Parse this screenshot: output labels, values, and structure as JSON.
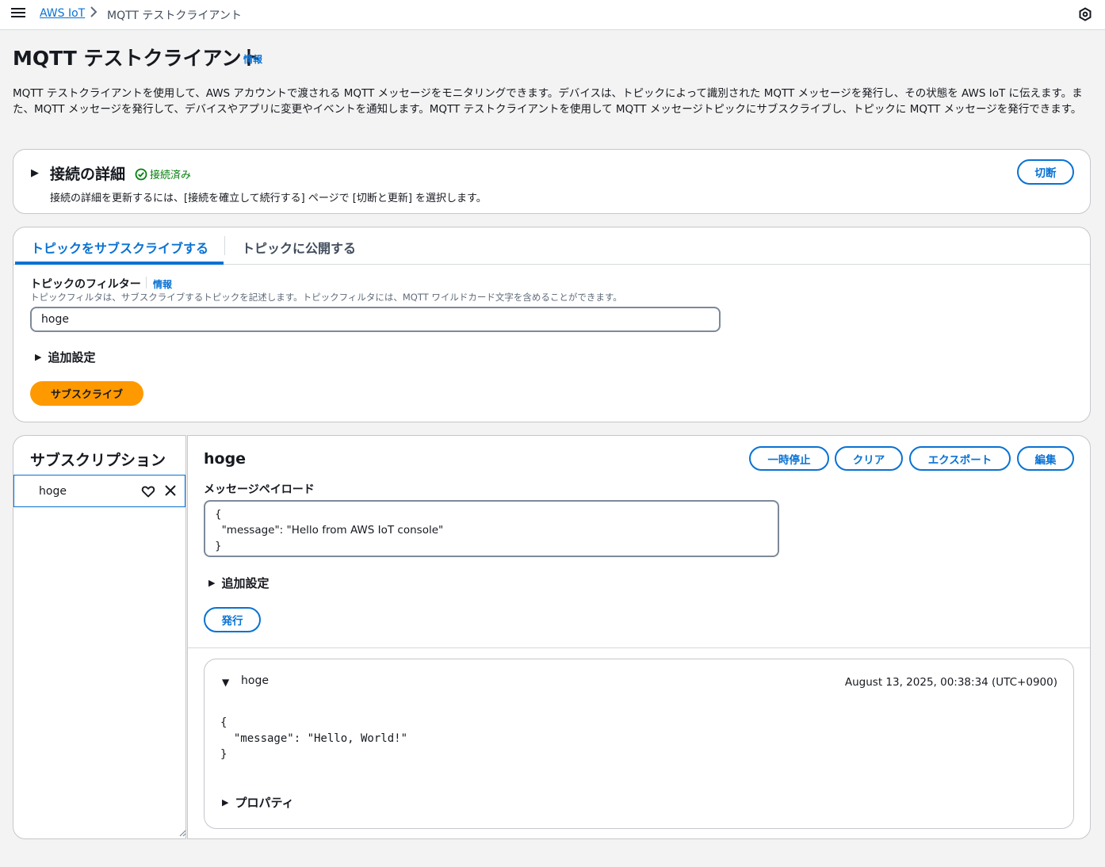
{
  "breadcrumb": {
    "root": "AWS IoT",
    "separator": "›",
    "current": "MQTT テストクライアント"
  },
  "page": {
    "title": "MQTT テストクライアント",
    "info": "情報",
    "description": "MQTT テストクライアントを使用して、AWS アカウントで渡される MQTT メッセージをモニタリングできます。デバイスは、トピックによって識別された MQTT メッセージを発行し、その状態を AWS IoT に伝えます。また、MQTT メッセージを発行して、デバイスやアプリに変更やイベントを通知します。MQTT テストクライアントを使用して MQTT メッセージトピックにサブスクライブし、トピックに MQTT メッセージを発行できます。"
  },
  "connection": {
    "title": "接続の詳細",
    "status": "接続済み",
    "note": "接続の詳細を更新するには、[接続を確立して続行する] ページで [切断と更新] を選択します。",
    "disconnect_label": "切断"
  },
  "tabs": {
    "subscribe": "トピックをサブスクライブする",
    "publish": "トピックに公開する"
  },
  "subscribe_form": {
    "filter_label": "トピックのフィルター",
    "info": "情報",
    "filter_desc": "トピックフィルタは、サブスクライブするトピックを記述します。トピックフィルタには、MQTT ワイルドカード文字を含めることができます。",
    "filter_value": "hoge",
    "extra_settings": "追加設定",
    "subscribe_label": "サブスクライブ"
  },
  "subscriptions": {
    "title": "サブスクリプション",
    "items": [
      {
        "label": "hoge"
      }
    ]
  },
  "message_panel": {
    "topic": "hoge",
    "pause_label": "一時停止",
    "clear_label": "クリア",
    "export_label": "エクスポート",
    "edit_label": "編集",
    "payload_label": "メッセージペイロード",
    "payload_value": "{\n  \"message\": \"Hello from AWS IoT console\"\n}",
    "extra_settings": "追加設定",
    "publish_label": "発行"
  },
  "received_message": {
    "topic": "hoge",
    "timestamp": "August 13, 2025, 00:38:34 (UTC+0900)",
    "body": "{\n  \"message\": \"Hello, World!\"\n}",
    "properties": "プロパティ"
  },
  "colors": {
    "link": "#0972d3",
    "primary_button": "#ff9900",
    "success": "#037f0c"
  }
}
